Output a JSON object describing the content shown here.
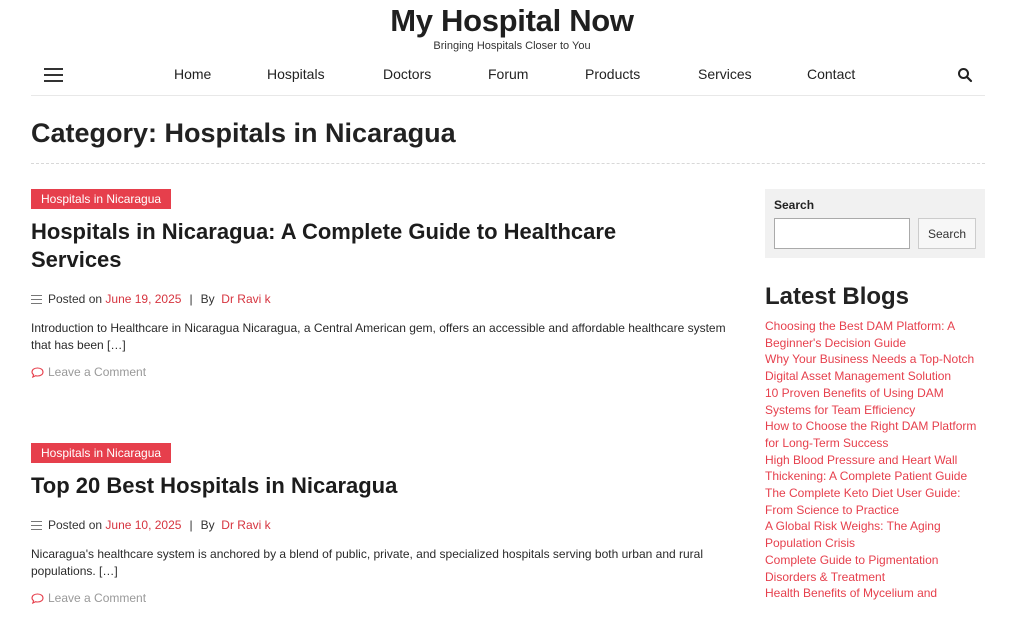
{
  "site": {
    "title": "My Hospital Now",
    "tagline": "Bringing Hospitals Closer to You"
  },
  "nav": {
    "items": [
      "Home",
      "Hospitals",
      "Doctors",
      "Forum",
      "Products",
      "Services",
      "Contact"
    ]
  },
  "page": {
    "title": "Category: Hospitals in Nicaragua"
  },
  "posts": [
    {
      "category": "Hospitals in Nicaragua",
      "title": "Hospitals in Nicaragua: A Complete Guide to Healthcare Services",
      "posted_on": "Posted on",
      "date": "June 19, 2025",
      "by": "By",
      "author": "Dr Ravi k",
      "excerpt": "Introduction to Healthcare in Nicaragua Nicaragua, a Central American gem, offers an accessible and affordable healthcare system that has been […]",
      "comment": "Leave a Comment"
    },
    {
      "category": "Hospitals in Nicaragua",
      "title": "Top 20 Best Hospitals in Nicaragua",
      "posted_on": "Posted on",
      "date": "June 10, 2025",
      "by": "By",
      "author": "Dr Ravi k",
      "excerpt": "Nicaragua's healthcare system is anchored by a blend of public, private, and specialized hospitals serving both urban and rural populations. […]",
      "comment": "Leave a Comment"
    }
  ],
  "sidebar": {
    "search_label": "Search",
    "search_button": "Search",
    "latest_title": "Latest Blogs",
    "blogs": [
      "Choosing the Best DAM Platform: A Beginner's Decision Guide",
      "Why Your Business Needs a Top-Notch Digital Asset Management Solution",
      "10 Proven Benefits of Using DAM Systems for Team Efficiency",
      "How to Choose the Right DAM Platform for Long-Term Success",
      "High Blood Pressure and Heart Wall Thickening: A Complete Patient Guide",
      "The Complete Keto Diet User Guide: From Science to Practice",
      "A Global Risk Weighs: The Aging Population Crisis",
      "Complete Guide to Pigmentation Disorders & Treatment",
      "Health Benefits of Mycelium and"
    ]
  },
  "colors": {
    "accent": "#e63f4c"
  }
}
